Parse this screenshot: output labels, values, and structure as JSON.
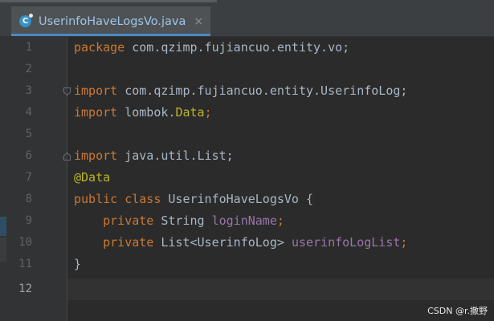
{
  "tab": {
    "title": "UserinfoHaveLogsVo.java",
    "icon_letter": "C",
    "close_glyph": "×"
  },
  "gutter": {
    "line_numbers": [
      "1",
      "2",
      "3",
      "4",
      "5",
      "6",
      "7",
      "8",
      "9",
      "10",
      "11",
      "12"
    ]
  },
  "code": {
    "line1": {
      "kw": "package",
      "rest": " com.qzimp.fujiancuo.entity.vo;"
    },
    "line3": {
      "kw": "import",
      "rest": " com.qzimp.fujiancuo.entity.UserinfoLog;"
    },
    "line4": {
      "kw": "import",
      "mid": " lombok.",
      "ann": "Data",
      "semi": ";"
    },
    "line6": {
      "kw": "import",
      "rest": " java.util.List;"
    },
    "line7": {
      "ann": "@Data"
    },
    "line8": {
      "kw": "public class",
      "rest": " UserinfoHaveLogsVo {"
    },
    "line9": {
      "indent": "    ",
      "kw": "private",
      "type": " String ",
      "field": "loginName",
      "semi": ";"
    },
    "line10": {
      "indent": "    ",
      "kw": "private",
      "type": " List<UserinfoLog> ",
      "field": "userinfoLogList",
      "semi": ";"
    },
    "line11": {
      "text": "}"
    }
  },
  "watermark": "CSDN @r.撒野",
  "colors": {
    "editor_bg": "#2b2b2b",
    "gutter_bg": "#313335",
    "keyword": "#cc7832",
    "annotation": "#bbb529",
    "field": "#9876aa",
    "text": "#a9b7c6",
    "tab_accent": "#4a88c7"
  }
}
